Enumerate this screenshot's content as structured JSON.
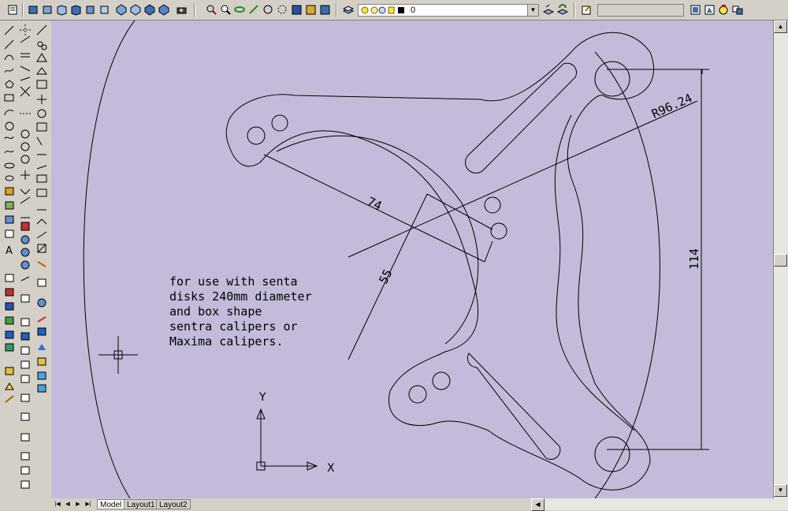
{
  "toolbar": {
    "layer": {
      "current_value": "0"
    },
    "color_control": {
      "value": ""
    }
  },
  "drawing": {
    "note_lines": [
      "for use with senta",
      "disks 240mm diameter",
      "and box shape",
      "sentra calipers or",
      "Maxima calipers."
    ],
    "dimensions": {
      "radius": "R96.24",
      "horizontal": "74",
      "vertical_left": "55",
      "vertical_right": "114"
    },
    "ucs": {
      "x_label": "X",
      "y_label": "Y"
    }
  },
  "layout_tabs": [
    "Model",
    "Layout1",
    "Layout2"
  ]
}
